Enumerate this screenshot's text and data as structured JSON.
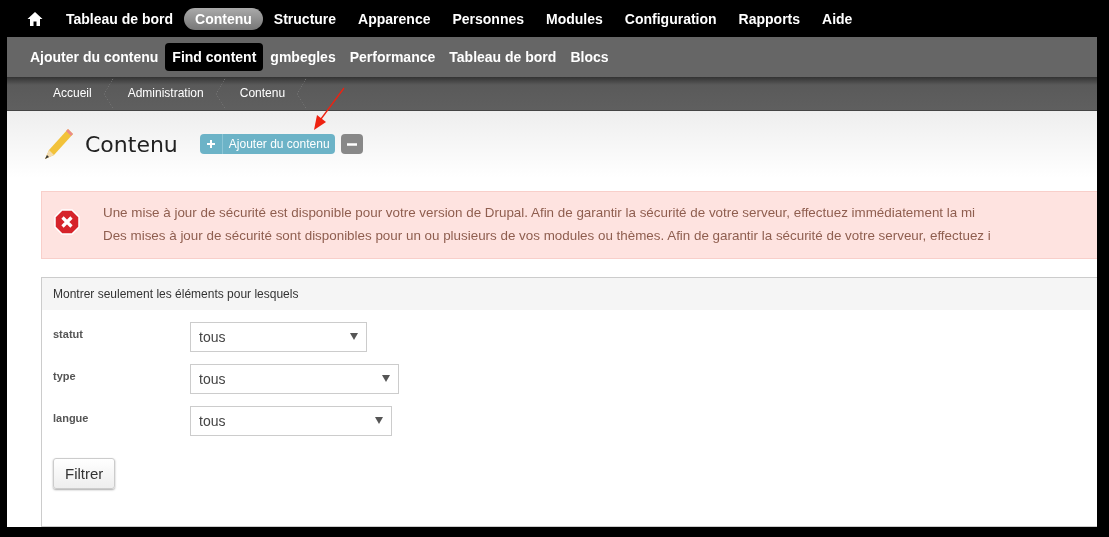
{
  "toolbar": {
    "items": [
      {
        "label": "Tableau de bord",
        "selected": false
      },
      {
        "label": "Contenu",
        "selected": true
      },
      {
        "label": "Structure",
        "selected": false
      },
      {
        "label": "Apparence",
        "selected": false
      },
      {
        "label": "Personnes",
        "selected": false
      },
      {
        "label": "Modules",
        "selected": false
      },
      {
        "label": "Configuration",
        "selected": false
      },
      {
        "label": "Rapports",
        "selected": false
      },
      {
        "label": "Aide",
        "selected": false
      }
    ]
  },
  "shortcuts": {
    "items": [
      {
        "label": "Ajouter du contenu",
        "selected": false
      },
      {
        "label": "Find content",
        "selected": true
      },
      {
        "label": "gmbegles",
        "selected": false
      },
      {
        "label": "Performance",
        "selected": false
      },
      {
        "label": "Tableau de bord",
        "selected": false
      },
      {
        "label": "Blocs",
        "selected": false
      }
    ]
  },
  "breadcrumb": [
    "Accueil",
    "Administration",
    "Contenu"
  ],
  "page": {
    "title": "Contenu",
    "action_button": "Ajouter du contenu"
  },
  "messages": [
    "Une mise à jour de sécurité est disponible pour votre version de Drupal. Afin de garantir la sécurité de votre serveur, effectuez immédiatement la mi",
    "Des mises à jour de sécurité sont disponibles pour un ou plusieurs de vos modules ou thèmes. Afin de garantir la sécurité de votre serveur, effectuez i"
  ],
  "filter": {
    "legend": "Montrer seulement les éléments pour lesquels",
    "fields": [
      {
        "label": "statut",
        "value": "tous"
      },
      {
        "label": "type",
        "value": "tous"
      },
      {
        "label": "langue",
        "value": "tous"
      }
    ],
    "submit": "Filtrer"
  }
}
